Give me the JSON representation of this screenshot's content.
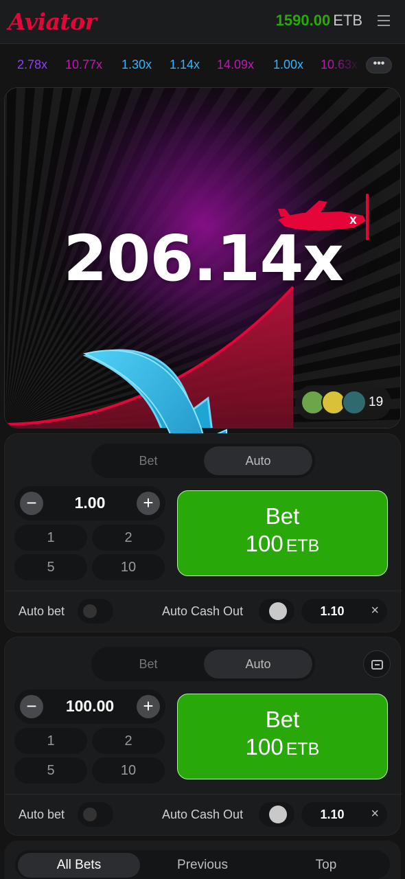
{
  "header": {
    "logo": "Aviator",
    "balance_amount": "1590.00",
    "balance_currency": "ETB"
  },
  "history": {
    "items": [
      {
        "value": "2.78x",
        "color": "#913ef8"
      },
      {
        "value": "10.77x",
        "color": "#c017b4"
      },
      {
        "value": "1.30x",
        "color": "#34b4ff"
      },
      {
        "value": "1.14x",
        "color": "#34b4ff"
      },
      {
        "value": "14.09x",
        "color": "#c017b4"
      },
      {
        "value": "1.00x",
        "color": "#34b4ff"
      },
      {
        "value": "10.63x",
        "color": "#c017b4"
      }
    ],
    "more_label": "•••"
  },
  "game": {
    "multiplier": "206.14x",
    "players_count": "19",
    "plane_color": "#e50539"
  },
  "bet_panels": [
    {
      "tab_bet": "Bet",
      "tab_auto": "Auto",
      "active_tab": "Auto",
      "amount": "1.00",
      "minus": "−",
      "plus": "+",
      "quick_amounts": [
        "1",
        "2",
        "5",
        "10"
      ],
      "bet_label": "Bet",
      "bet_amount": "100",
      "bet_currency": "ETB",
      "auto_bet_label": "Auto bet",
      "auto_cashout_label": "Auto Cash Out",
      "cashout_value": "1.10",
      "clear": "×"
    },
    {
      "tab_bet": "Bet",
      "tab_auto": "Auto",
      "active_tab": "Auto",
      "amount": "100.00",
      "minus": "−",
      "plus": "+",
      "quick_amounts": [
        "1",
        "2",
        "5",
        "10"
      ],
      "bet_label": "Bet",
      "bet_amount": "100",
      "bet_currency": "ETB",
      "auto_bet_label": "Auto bet",
      "auto_cashout_label": "Auto Cash Out",
      "cashout_value": "1.10",
      "clear": "×"
    }
  ],
  "bottom_tabs": {
    "items": [
      "All Bets",
      "Previous",
      "Top"
    ],
    "active": "All Bets"
  },
  "colors": {
    "brand_red": "#e50539",
    "bet_green": "#28a909",
    "arrow_blue": "#1fa4d6"
  }
}
